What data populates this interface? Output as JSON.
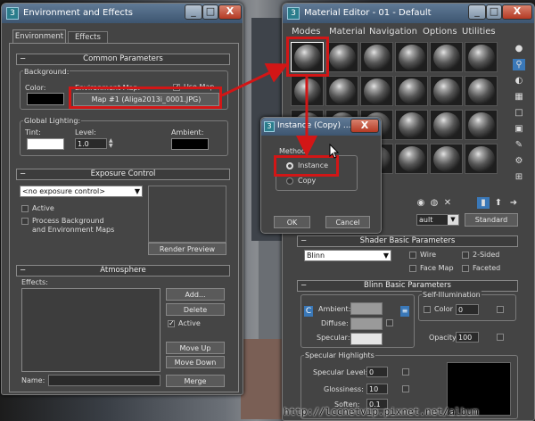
{
  "env_window": {
    "title": "Environment and Effects",
    "tabs": [
      "Environment",
      "Effects"
    ],
    "common": {
      "header": "Common Parameters",
      "background_label": "Background:",
      "color_label": "Color:",
      "env_map_label": "Environment Map:",
      "use_map_label": "Use Map",
      "map_button": "Map #1 (Aliga2013i_0001.JPG)",
      "global_lighting_label": "Global Lighting:",
      "tint_label": "Tint:",
      "level_label": "Level:",
      "level_value": "1.0",
      "ambient_label": "Ambient:"
    },
    "exposure": {
      "header": "Exposure Control",
      "dropdown": "<no exposure control>",
      "active_label": "Active",
      "process_bg_label": "Process Background\nand Environment Maps",
      "render_preview": "Render Preview"
    },
    "atmosphere": {
      "header": "Atmosphere",
      "effects_label": "Effects:",
      "add": "Add...",
      "delete": "Delete",
      "active": "Active",
      "move_up": "Move Up",
      "move_down": "Move Down",
      "name_label": "Name:",
      "merge": "Merge"
    }
  },
  "mat_window": {
    "title": "Material Editor - 01 - Default",
    "menu": [
      "Modes",
      "Material",
      "Navigation",
      "Options",
      "Utilities"
    ],
    "material_name": "ault",
    "standard_button": "Standard",
    "shader_header": "Shader Basic Parameters",
    "shader_type": "Blinn",
    "wire": "Wire",
    "two_sided": "2-Sided",
    "face_map": "Face Map",
    "faceted": "Faceted",
    "blinn_header": "Blinn Basic Parameters",
    "self_illum_label": "Self-Illumination",
    "color_label": "Color",
    "self_illum_value": "0",
    "ambient_label": "Ambient:",
    "diffuse_label": "Diffuse:",
    "specular_label": "Specular:",
    "opacity_label": "Opacity:",
    "opacity_value": "100",
    "spec_hl_label": "Specular Highlights",
    "spec_level_label": "Specular Level:",
    "spec_level_value": "0",
    "glossiness_label": "Glossiness:",
    "glossiness_value": "10",
    "soften_label": "Soften:",
    "soften_value": "0.1"
  },
  "dialog": {
    "title": "Instance (Copy) ...",
    "method_label": "Method",
    "option_instance": "Instance",
    "option_copy": "Copy",
    "ok": "OK",
    "cancel": "Cancel",
    "selected": "Instance"
  },
  "watermark": "http://lccnetvip.pixnet.net/album",
  "colors": {
    "annotation_red": "#d21616",
    "titlebar": "#4a6a8c"
  }
}
